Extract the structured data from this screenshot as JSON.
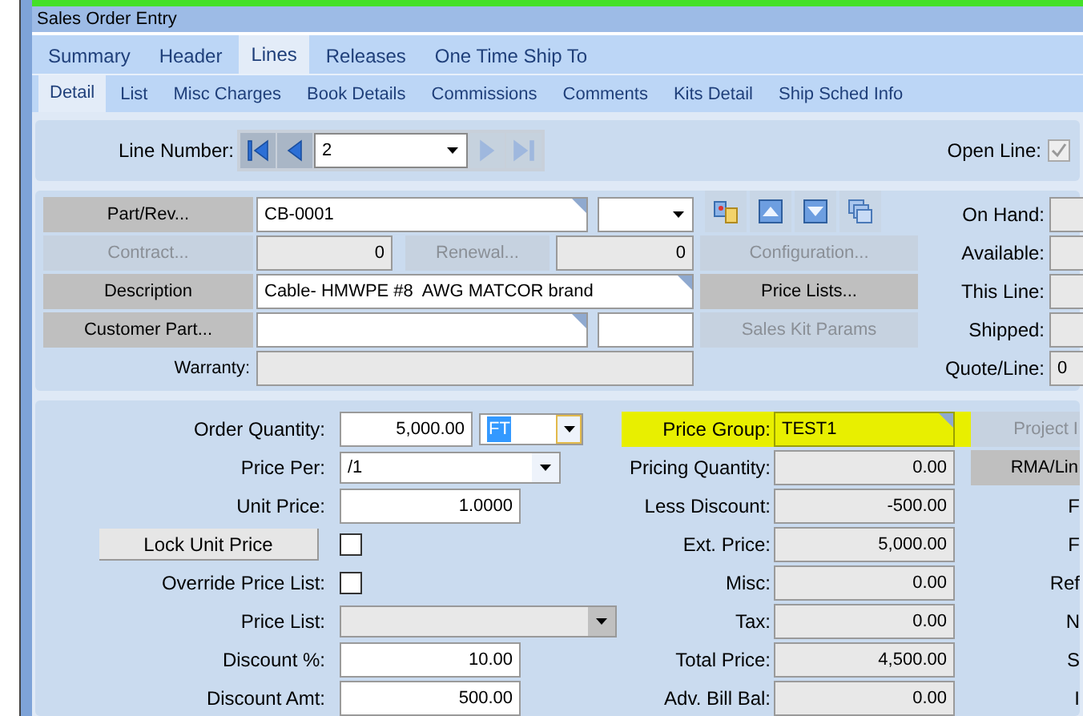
{
  "window": {
    "title": "Sales Order Entry"
  },
  "tabs": [
    {
      "label": "Summary",
      "selected": false
    },
    {
      "label": "Header",
      "selected": false
    },
    {
      "label": "Lines",
      "selected": true
    },
    {
      "label": "Releases",
      "selected": false
    },
    {
      "label": "One Time Ship To",
      "selected": false
    }
  ],
  "subtabs": [
    {
      "label": "Detail",
      "selected": true
    },
    {
      "label": "List",
      "selected": false
    },
    {
      "label": "Misc Charges",
      "selected": false
    },
    {
      "label": "Book Details",
      "selected": false
    },
    {
      "label": "Commissions",
      "selected": false
    },
    {
      "label": "Comments",
      "selected": false
    },
    {
      "label": "Kits Detail",
      "selected": false
    },
    {
      "label": "Ship Sched Info",
      "selected": false
    }
  ],
  "line_number": {
    "label": "Line Number:",
    "value": "2"
  },
  "open_line": {
    "label": "Open Line:",
    "checked": true
  },
  "part": {
    "part_button": "Part/Rev...",
    "part_value": "CB-0001",
    "contract_button": "Contract...",
    "contract_value": "0",
    "renewal_button": "Renewal...",
    "renewal_value": "0",
    "description_button": "Description",
    "description_value": "Cable- HMWPE #8  AWG MATCOR brand",
    "customer_part_button": "Customer Part...",
    "warranty_label": "Warranty:"
  },
  "actions": [
    {
      "label": "Configuration...",
      "disabled": true
    },
    {
      "label": "Price Lists...",
      "disabled": false
    },
    {
      "label": "Sales Kit Params",
      "disabled": true
    }
  ],
  "stock": [
    {
      "label": "On Hand:"
    },
    {
      "label": "Available:"
    },
    {
      "label": "This Line:"
    },
    {
      "label": "Shipped:"
    },
    {
      "label": "Quote/Line:",
      "value": "0"
    }
  ],
  "pricing_left": [
    {
      "kind": "qty",
      "label": "Order Quantity:",
      "value": "5,000.00",
      "unit": "FT"
    },
    {
      "kind": "select",
      "label": "Price Per:",
      "value": "/1",
      "disabled": false
    },
    {
      "kind": "field",
      "label": "Unit Price:",
      "value": "1.0000"
    },
    {
      "kind": "button",
      "label": "Lock Unit Price",
      "checked": false
    },
    {
      "kind": "check",
      "label": "Override Price List:",
      "checked": false
    },
    {
      "kind": "select",
      "label": "Price List:",
      "disabled": true
    },
    {
      "kind": "field",
      "label": "Discount %:",
      "value": "10.00"
    },
    {
      "kind": "field",
      "label": "Discount Amt:",
      "value": "500.00"
    }
  ],
  "pricing_mid": [
    {
      "label": "Price Group:",
      "value": "TEST1",
      "highlighted": true
    },
    {
      "label": "Pricing Quantity:",
      "value": "0.00",
      "highlighted": false
    },
    {
      "label": "Less Discount:",
      "value": "-500.00",
      "highlighted": false
    },
    {
      "label": "Ext. Price:",
      "value": "5,000.00",
      "highlighted": false
    },
    {
      "label": "Misc:",
      "value": "0.00",
      "highlighted": false
    },
    {
      "label": "Tax:",
      "value": "0.00",
      "highlighted": false
    },
    {
      "label": "Total Price:",
      "value": "4,500.00",
      "highlighted": false
    },
    {
      "label": "Adv. Bill Bal:",
      "value": "0.00",
      "highlighted": false
    }
  ],
  "pricing_right": [
    {
      "kind": "button",
      "label": "Project I",
      "disabled": true
    },
    {
      "kind": "button",
      "label": "RMA/Lin",
      "disabled": false
    },
    {
      "kind": "label",
      "label": "F"
    },
    {
      "kind": "label",
      "label": "F"
    },
    {
      "kind": "label",
      "label": "Ref"
    },
    {
      "kind": "label",
      "label": "N"
    },
    {
      "kind": "label",
      "label": "S"
    },
    {
      "kind": "label",
      "label": "I"
    }
  ]
}
